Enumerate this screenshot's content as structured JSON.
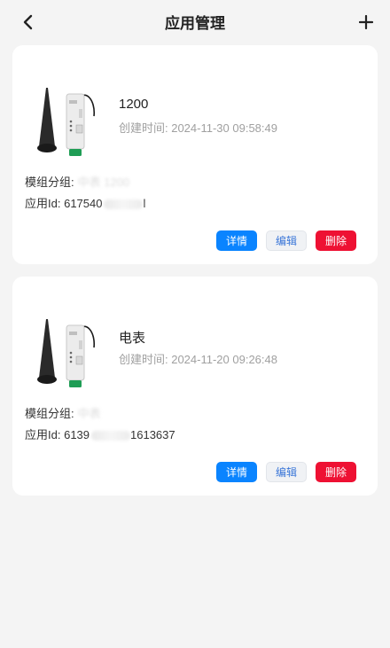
{
  "header": {
    "title": "应用管理",
    "back_icon": "chevron-left-icon",
    "add_icon": "plus-icon"
  },
  "cards": [
    {
      "name": "1200",
      "time_label": "创建时间: 2024-11-30 09:58:49",
      "group_label": "模组分组:",
      "group_value": "中表 1200",
      "appid_label": "应用Id:",
      "appid_prefix": "617540",
      "appid_suffix": "l",
      "buttons": {
        "detail": "详情",
        "edit": "编辑",
        "delete": "删除"
      }
    },
    {
      "name": "电表",
      "time_label": "创建时间: 2024-11-20 09:26:48",
      "group_label": "模组分组:",
      "group_value": "中表",
      "appid_label": "应用Id:",
      "appid_prefix": "6139",
      "appid_suffix": "1613637",
      "buttons": {
        "detail": "详情",
        "edit": "编辑",
        "delete": "删除"
      }
    }
  ],
  "colors": {
    "detail": "#0a84ff",
    "edit_text": "#3a76d8",
    "delete": "#ee1133",
    "background": "#f4f4f4"
  }
}
